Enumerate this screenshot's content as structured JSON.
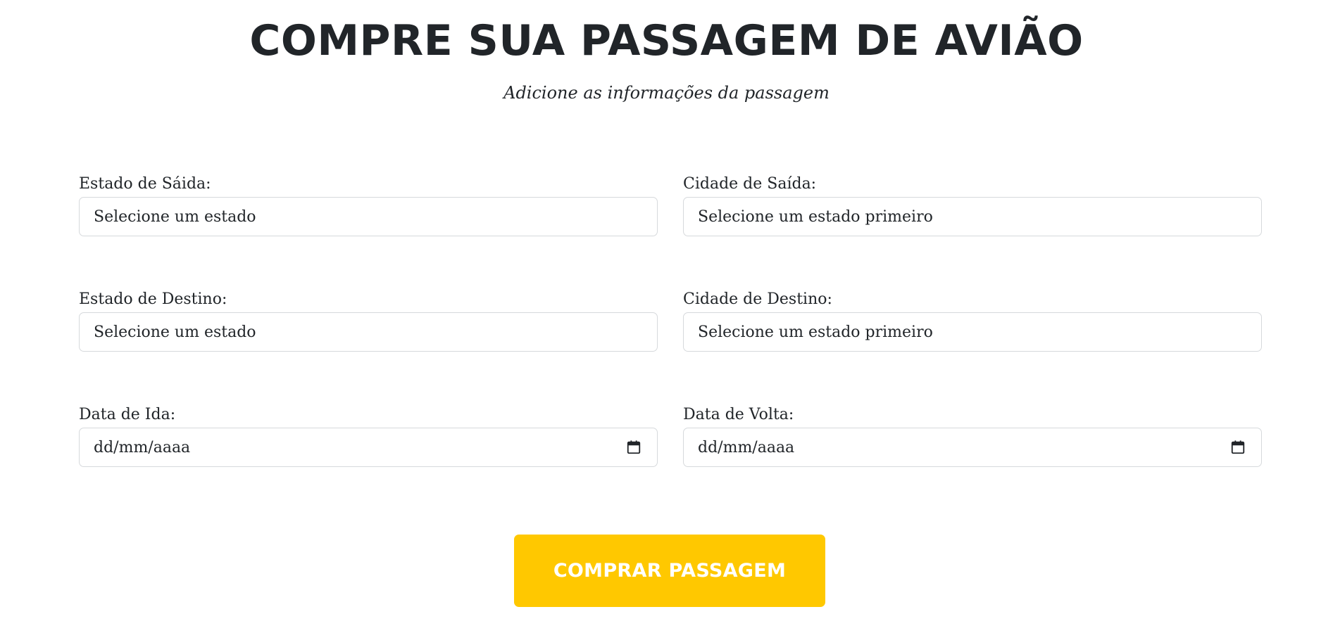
{
  "header": {
    "title": "COMPRE SUA PASSAGEM DE AVIÃO",
    "subtitle": "Adicione as informações da passagem"
  },
  "form": {
    "departure_state": {
      "label": "Estado de Sáida:",
      "value": "Selecione um estado"
    },
    "departure_city": {
      "label": "Cidade de Saída:",
      "value": "Selecione um estado primeiro"
    },
    "destination_state": {
      "label": "Estado de Destino:",
      "value": "Selecione um estado"
    },
    "destination_city": {
      "label": "Cidade de Destino:",
      "value": "Selecione um estado primeiro"
    },
    "departure_date": {
      "label": "Data de Ida:",
      "value": "dd/mm/aaaa",
      "icon": "calendar-icon"
    },
    "return_date": {
      "label": "Data de Volta:",
      "value": "dd/mm/aaaa",
      "icon": "calendar-icon"
    },
    "submit_label": "COMPRAR PASSAGEM"
  },
  "colors": {
    "button_background": "#ffc800",
    "button_text": "#ffffff",
    "text": "#212529",
    "field_border": "#d6d9dc"
  }
}
